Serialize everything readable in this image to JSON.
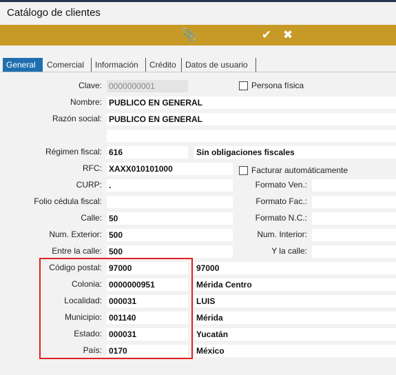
{
  "window": {
    "title": "Catálogo de clientes"
  },
  "toolbar": {
    "icons": [
      "paperclip-icon",
      "check-circle-icon",
      "close-circle-icon"
    ]
  },
  "tabs": [
    "General",
    "Comercial",
    "Información",
    "Crédito",
    "Datos de usuario"
  ],
  "form": {
    "clave": {
      "label": "Clave:",
      "value": "0000000001"
    },
    "persona_fisica": {
      "label": "Persona física",
      "checked": false
    },
    "nombre": {
      "label": "Nombre:",
      "value": "PUBLICO EN GENERAL"
    },
    "razon_social": {
      "label": "Razón social:",
      "value": "PUBLICO EN GENERAL",
      "value2": ""
    },
    "regimen_fiscal": {
      "label": "Régimen fiscal:",
      "value": "616",
      "description": "Sin obligaciones fiscales"
    },
    "rfc": {
      "label": "RFC:",
      "value": "XAXX010101000"
    },
    "facturar_auto": {
      "label": "Facturar automáticamente",
      "checked": false
    },
    "curp": {
      "label": "CURP:",
      "value": "."
    },
    "formato_ven": {
      "label": "Formato Ven.:",
      "value": ""
    },
    "folio_cedula": {
      "label": "Folio cédula fiscal:",
      "value": ""
    },
    "formato_fac": {
      "label": "Formato Fac.:",
      "value": ""
    },
    "calle": {
      "label": "Calle:",
      "value": "50"
    },
    "formato_nc": {
      "label": "Formato N.C.:",
      "value": ""
    },
    "num_exterior": {
      "label": "Num. Exterior:",
      "value": "500"
    },
    "num_interior": {
      "label": "Num. Interior:",
      "value": ""
    },
    "entre_calle": {
      "label": "Entre la calle:",
      "value": "500"
    },
    "y_la_calle": {
      "label": "Y la calle:",
      "value": ""
    },
    "codigo_postal": {
      "label": "Código postal:",
      "value": "97000",
      "description": "97000"
    },
    "colonia": {
      "label": "Colonia:",
      "value": "0000000951",
      "description": "Mérida Centro"
    },
    "localidad": {
      "label": "Localidad:",
      "value": "000031",
      "description": "LUIS"
    },
    "municipio": {
      "label": "Municipio:",
      "value": "001140",
      "description": "Mérida"
    },
    "estado": {
      "label": "Estado:",
      "value": "000031",
      "description": "Yucatán"
    },
    "pais": {
      "label": "País:",
      "value": "0170",
      "description": "México"
    }
  },
  "colors": {
    "toolbar": "#c79a27",
    "active_tab": "#1f6fb0",
    "highlight_box": "#e02020"
  }
}
